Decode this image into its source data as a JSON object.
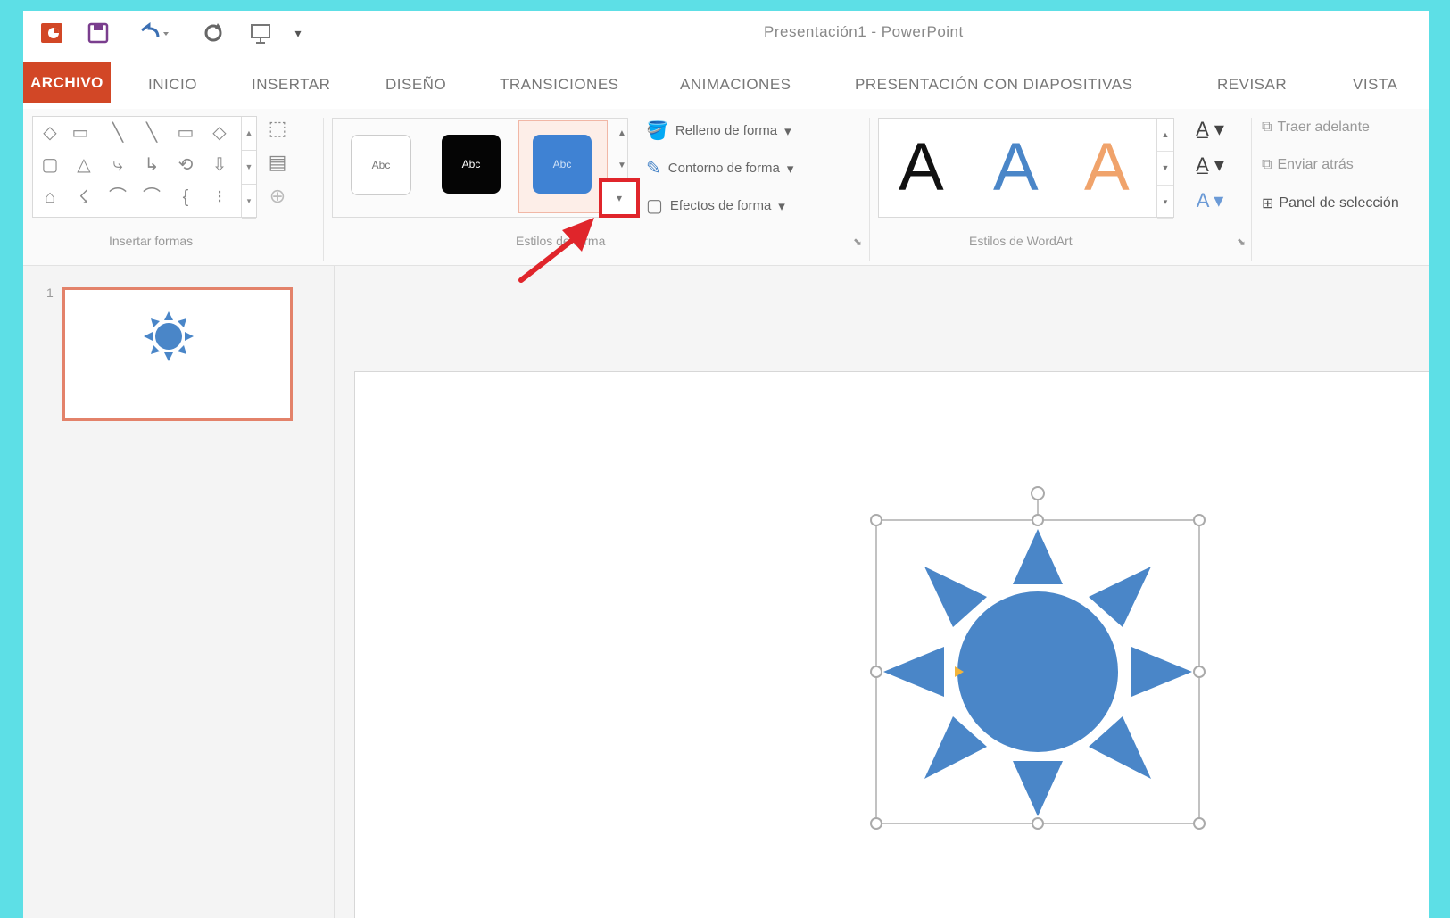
{
  "window": {
    "title": "Presentación1 - PowerPoint"
  },
  "quick_access": {
    "icons": [
      "powerpoint-logo-icon",
      "save-icon",
      "undo-icon",
      "redo-icon",
      "start-from-beginning-icon",
      "customize-qat-icon"
    ]
  },
  "tabs": [
    {
      "label": "ARCHIVO"
    },
    {
      "label": "INICIO"
    },
    {
      "label": "INSERTAR"
    },
    {
      "label": "DISEÑO"
    },
    {
      "label": "TRANSICIONES"
    },
    {
      "label": "ANIMACIONES"
    },
    {
      "label": "PRESENTACIÓN CON DIAPOSITIVAS"
    },
    {
      "label": "REVISAR"
    },
    {
      "label": "VISTA"
    }
  ],
  "ribbon": {
    "insert_shapes": {
      "label": "Insertar formas"
    },
    "shape_styles": {
      "label": "Estilos de forma",
      "thumb_text": "Abc",
      "fill": "Relleno de forma",
      "outline": "Contorno de forma",
      "effects": "Efectos de forma"
    },
    "wordart": {
      "label": "Estilos de WordArt",
      "letter": "A"
    },
    "arrange": {
      "bring_forward": "Traer adelante",
      "send_backward": "Enviar atrás",
      "selection_pane": "Panel de selección"
    }
  },
  "slides_pane": {
    "slide_number": "1"
  },
  "colors": {
    "file_tab": "#d24726",
    "shape_blue": "#4a86c8",
    "highlight_red": "#e0252b",
    "frame_cyan": "#5ddfe6"
  }
}
